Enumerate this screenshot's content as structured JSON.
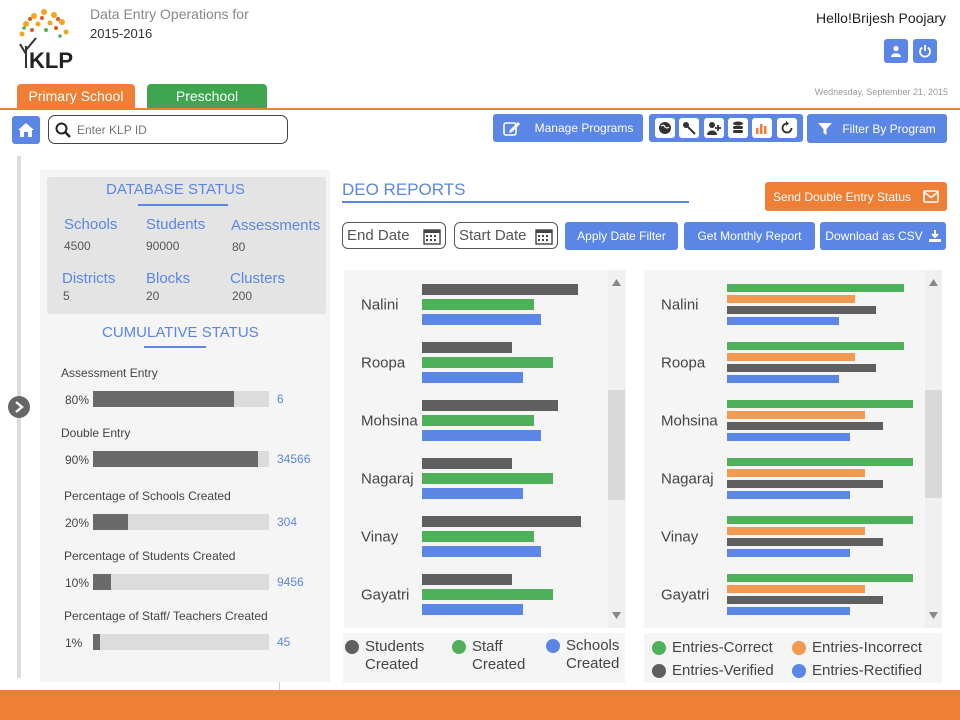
{
  "header": {
    "ops_label": "Data Entry Operations for",
    "year": "2015-2016",
    "logo_text": "KLP",
    "hello": "Hello!",
    "user_name": "Brijesh Poojary",
    "date": "Wednesday, September 21, 2015"
  },
  "tabs": [
    {
      "label": "Primary School",
      "color": "#f07f36"
    },
    {
      "label": "Preschool",
      "color": "#3fa650"
    }
  ],
  "toolbar": {
    "search_placeholder": "Enter KLP ID",
    "manage_label": "Manage Programs",
    "filter_label": "Filter By Program",
    "icons": [
      "globe-icon",
      "key-icon",
      "add-user-icon",
      "database-icon",
      "chart-icon",
      "refresh-icon"
    ]
  },
  "database_status": {
    "title": "DATABASE STATUS",
    "stats": [
      {
        "label": "Schools",
        "value": "4500"
      },
      {
        "label": "Students",
        "value": "90000"
      },
      {
        "label": "Assessments",
        "value": "80"
      },
      {
        "label": "Districts",
        "value": "5"
      },
      {
        "label": "Blocks",
        "value": "20"
      },
      {
        "label": "Clusters",
        "value": "200"
      }
    ]
  },
  "cumulative_status": {
    "title": "CUMULATIVE STATUS",
    "items": [
      {
        "label": "Assessment Entry",
        "percent_label": "80%",
        "fraction": 0.8,
        "count": "6"
      },
      {
        "label": "Double Entry",
        "percent_label": "90%",
        "fraction": 0.94,
        "count": "34566"
      },
      {
        "label": "Percentage of Schools Created",
        "percent_label": "20%",
        "fraction": 0.2,
        "count": "304"
      },
      {
        "label": "Percentage of Students Created",
        "percent_label": "10%",
        "fraction": 0.1,
        "count": "9456"
      },
      {
        "label": "Percentage of Staff/ Teachers Created",
        "percent_label": "1%",
        "fraction": 0.04,
        "count": "45"
      }
    ]
  },
  "deo_reports": {
    "title": "DEO REPORTS",
    "send_label": "Send Double Entry Status",
    "end_date_placeholder": "End Date",
    "start_date_placeholder": "Start Date",
    "apply_label": "Apply Date Filter",
    "monthly_label": "Get Monthly Report",
    "csv_label": "Download as CSV"
  },
  "chart_data": [
    {
      "type": "bar",
      "orientation": "horizontal",
      "categories": [
        "Nalini",
        "Roopa",
        "Mohsina",
        "Nagaraj",
        "Vinay",
        "Gayatri"
      ],
      "xlim": [
        0,
        100
      ],
      "series": [
        {
          "name": "Students Created",
          "color": "#5f5f5f",
          "values": [
            100,
            58,
            87,
            58,
            102,
            58
          ]
        },
        {
          "name": "Staff Created",
          "color": "#4fb05a",
          "values": [
            72,
            84,
            72,
            84,
            72,
            84
          ]
        },
        {
          "name": "Schools Created",
          "color": "#5b86e5",
          "values": [
            76,
            65,
            76,
            65,
            76,
            65
          ]
        }
      ],
      "legend_position": "bottom"
    },
    {
      "type": "bar",
      "orientation": "horizontal",
      "categories": [
        "Nalini",
        "Roopa",
        "Mohsina",
        "Nagaraj",
        "Vinay",
        "Gayatri"
      ],
      "xlim": [
        0,
        100
      ],
      "series": [
        {
          "name": "Entries-Correct",
          "color": "#4fb05a",
          "values": [
            95,
            95,
            100,
            100,
            100,
            100
          ]
        },
        {
          "name": "Entries-Incorrect",
          "color": "#f39a52",
          "values": [
            69,
            69,
            74,
            74,
            74,
            74
          ]
        },
        {
          "name": "Entries-Verified",
          "color": "#5f5f5f",
          "values": [
            80,
            80,
            84,
            84,
            84,
            84
          ]
        },
        {
          "name": "Entries-Rectified",
          "color": "#5b86e5",
          "values": [
            60,
            60,
            66,
            66,
            66,
            66
          ]
        }
      ],
      "legend_position": "bottom"
    }
  ]
}
